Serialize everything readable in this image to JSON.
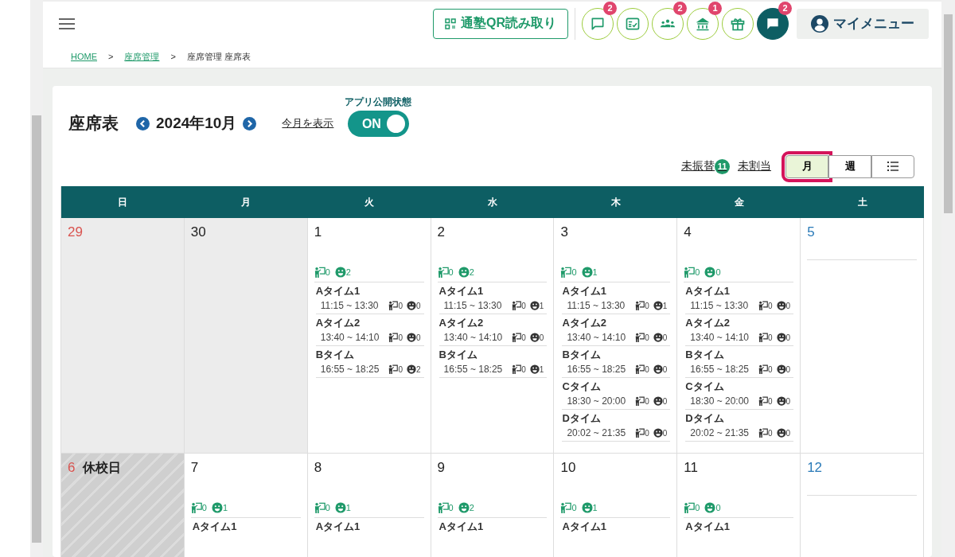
{
  "header": {
    "qr_button": "通塾QR読み取り",
    "icon_buttons": [
      {
        "kind": "chat",
        "badge": "2"
      },
      {
        "kind": "checklist"
      },
      {
        "kind": "group",
        "badge": "2"
      },
      {
        "kind": "building",
        "badge": "1"
      },
      {
        "kind": "gift"
      },
      {
        "kind": "message",
        "badge": "2"
      }
    ],
    "my_menu": "マイメニュー"
  },
  "breadcrumb": [
    {
      "label": "HOME",
      "link": true
    },
    {
      "label": "座席管理",
      "link": true
    },
    {
      "label": "座席管理 座席表",
      "link": false
    }
  ],
  "breadcrumb_separator": ">",
  "page": {
    "title": "座席表",
    "month": "2024年10月",
    "today_link": "今月を表示",
    "publish": {
      "label": "アプリ公開状態",
      "text": "ON",
      "on": true
    }
  },
  "filters": [
    {
      "label": "未振替",
      "badge": "11"
    },
    {
      "label": "未割当"
    }
  ],
  "views": [
    {
      "kind": "text",
      "label": "月",
      "selected": true,
      "highlighted": true
    },
    {
      "kind": "text",
      "label": "週",
      "selected": false,
      "highlighted": false
    },
    {
      "kind": "list",
      "selected": false,
      "highlighted": false
    }
  ],
  "weekdays": [
    "日",
    "月",
    "火",
    "水",
    "木",
    "金",
    "土"
  ],
  "weeks": [
    [
      {
        "date": "29",
        "outside_month": true
      },
      {
        "date": "30",
        "outside_month": true
      },
      {
        "date": "1",
        "outside_month": false,
        "teachers": "0",
        "students": "2",
        "slots": [
          {
            "name": "Aタイム1",
            "time": "11:15 ~ 13:30",
            "teachers": "0",
            "students": "0"
          },
          {
            "name": "Aタイム2",
            "time": "13:40 ~ 14:10",
            "teachers": "0",
            "students": "0"
          },
          {
            "name": "Bタイム",
            "time": "16:55 ~ 18:25",
            "teachers": "0",
            "students": "2"
          }
        ]
      },
      {
        "date": "2",
        "outside_month": false,
        "teachers": "0",
        "students": "2",
        "slots": [
          {
            "name": "Aタイム1",
            "time": "11:15 ~ 13:30",
            "teachers": "0",
            "students": "1"
          },
          {
            "name": "Aタイム2",
            "time": "13:40 ~ 14:10",
            "teachers": "0",
            "students": "0"
          },
          {
            "name": "Bタイム",
            "time": "16:55 ~ 18:25",
            "teachers": "0",
            "students": "1"
          }
        ]
      },
      {
        "date": "3",
        "outside_month": false,
        "teachers": "0",
        "students": "1",
        "slots": [
          {
            "name": "Aタイム1",
            "time": "11:15 ~ 13:30",
            "teachers": "0",
            "students": "1"
          },
          {
            "name": "Aタイム2",
            "time": "13:40 ~ 14:10",
            "teachers": "0",
            "students": "0"
          },
          {
            "name": "Bタイム",
            "time": "16:55 ~ 18:25",
            "teachers": "0",
            "students": "0"
          },
          {
            "name": "Cタイム",
            "time": "18:30 ~ 20:00",
            "teachers": "0",
            "students": "0"
          },
          {
            "name": "Dタイム",
            "time": "20:02 ~ 21:35",
            "teachers": "0",
            "students": "0"
          }
        ]
      },
      {
        "date": "4",
        "outside_month": false,
        "teachers": "0",
        "students": "0",
        "slots": [
          {
            "name": "Aタイム1",
            "time": "11:15 ~ 13:30",
            "teachers": "0",
            "students": "0"
          },
          {
            "name": "Aタイム2",
            "time": "13:40 ~ 14:10",
            "teachers": "0",
            "students": "0"
          },
          {
            "name": "Bタイム",
            "time": "16:55 ~ 18:25",
            "teachers": "0",
            "students": "0"
          },
          {
            "name": "Cタイム",
            "time": "18:30 ~ 20:00",
            "teachers": "0",
            "students": "0"
          },
          {
            "name": "Dタイム",
            "time": "20:02 ~ 21:35",
            "teachers": "0",
            "students": "0"
          }
        ]
      },
      {
        "date": "5",
        "outside_month": false
      }
    ],
    [
      {
        "date": "6",
        "outside_month": false,
        "closed": true,
        "closed_label": "休校日"
      },
      {
        "date": "7",
        "outside_month": false,
        "teachers": "0",
        "students": "1",
        "slots": [
          {
            "name": "Aタイム1"
          }
        ]
      },
      {
        "date": "8",
        "outside_month": false,
        "teachers": "0",
        "students": "1",
        "slots": [
          {
            "name": "Aタイム1"
          }
        ]
      },
      {
        "date": "9",
        "outside_month": false,
        "teachers": "0",
        "students": "2",
        "slots": [
          {
            "name": "Aタイム1"
          }
        ]
      },
      {
        "date": "10",
        "outside_month": false,
        "teachers": "0",
        "students": "1",
        "slots": [
          {
            "name": "Aタイム1"
          }
        ]
      },
      {
        "date": "11",
        "outside_month": false,
        "teachers": "0",
        "students": "0",
        "slots": [
          {
            "name": "Aタイム1"
          }
        ]
      },
      {
        "date": "12",
        "outside_month": false
      }
    ]
  ]
}
